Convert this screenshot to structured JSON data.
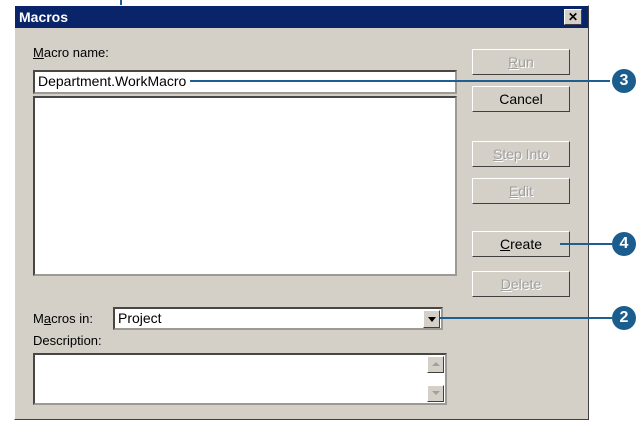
{
  "dialog": {
    "title": "Macros",
    "close_glyph": "✕",
    "macro_name": {
      "label_prefix": "",
      "label_mnemonic": "M",
      "label_rest": "acro name:",
      "value": "Department.WorkMacro"
    },
    "macros_in": {
      "label_prefix": "M",
      "label_mnemonic": "a",
      "label_rest": "cros in:",
      "value": "Project"
    },
    "description": {
      "label": "Description:"
    },
    "buttons": {
      "run": {
        "mnemonic": "R",
        "rest": "un"
      },
      "cancel": {
        "label": "Cancel"
      },
      "step_into": {
        "mnemonic": "S",
        "rest": "tep Into"
      },
      "edit": {
        "mnemonic": "E",
        "rest": "dit"
      },
      "create": {
        "mnemonic": "C",
        "rest": "reate"
      },
      "delete": {
        "mnemonic": "D",
        "rest": "elete"
      }
    }
  },
  "callouts": {
    "callout_2": "2",
    "callout_3": "3",
    "callout_4": "4"
  },
  "colors": {
    "titlebar": "#0a246a",
    "callout": "#1b5d8c",
    "dialog_bg": "#d4d0c8"
  }
}
